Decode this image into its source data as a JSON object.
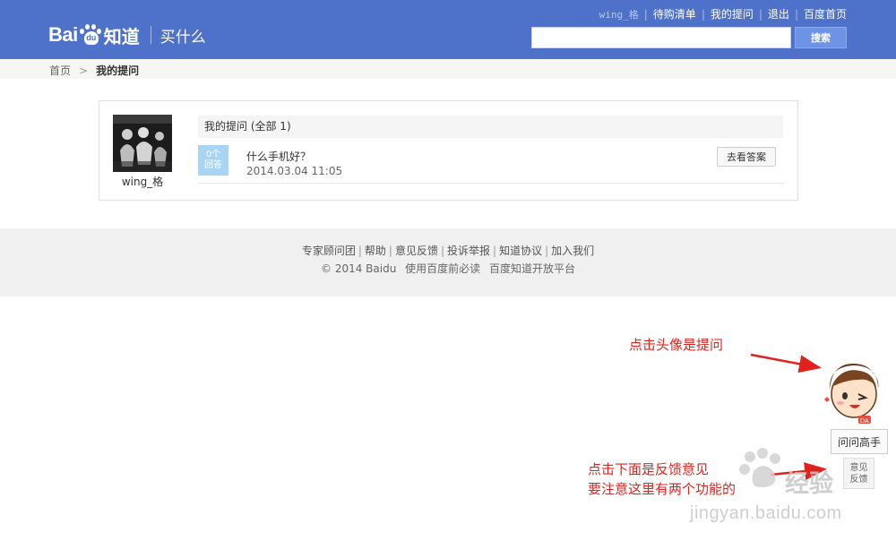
{
  "header": {
    "logo_bai": "Bai",
    "logo_du": "du",
    "logo_zhidao": "知道",
    "logo_sub": "买什么",
    "user": "wing_格",
    "links": [
      "待购清单",
      "我的提问",
      "退出",
      "百度首页"
    ],
    "search_value": "",
    "search_button": "搜索"
  },
  "breadcrumb": {
    "home": "首页",
    "arrow": ">",
    "current": "我的提问"
  },
  "card": {
    "username": "wing_格",
    "heading": "我的提问 (全部 1)",
    "question": {
      "badge_line1": "0个",
      "badge_line2": "回答",
      "title": "什么手机好？",
      "time": "2014.03.04 11:05",
      "button": "去看答案"
    }
  },
  "footer": {
    "links": [
      "专家顾问团",
      "帮助",
      "意见反馈",
      "投诉举报",
      "知道协议",
      "加入我们"
    ],
    "copyright": "© 2014 Baidu",
    "copy_links": [
      "使用百度前必读",
      "百度知道开放平台"
    ]
  },
  "annotations": {
    "note1": "点击头像是提问",
    "note2_line1": "点击下面是反馈意见",
    "note2_line2": "要注意这里有两个功能的"
  },
  "widget": {
    "ask_button": "问问高手",
    "feedback_line1": "意见",
    "feedback_line2": "反馈",
    "toon_tag": "DA"
  },
  "watermark": {
    "brand": "经验",
    "url": "jingyan.baidu.com"
  },
  "colors": {
    "header": "#4e71c9",
    "annotation": "#e1221c",
    "badge": "#a9d5f5"
  }
}
